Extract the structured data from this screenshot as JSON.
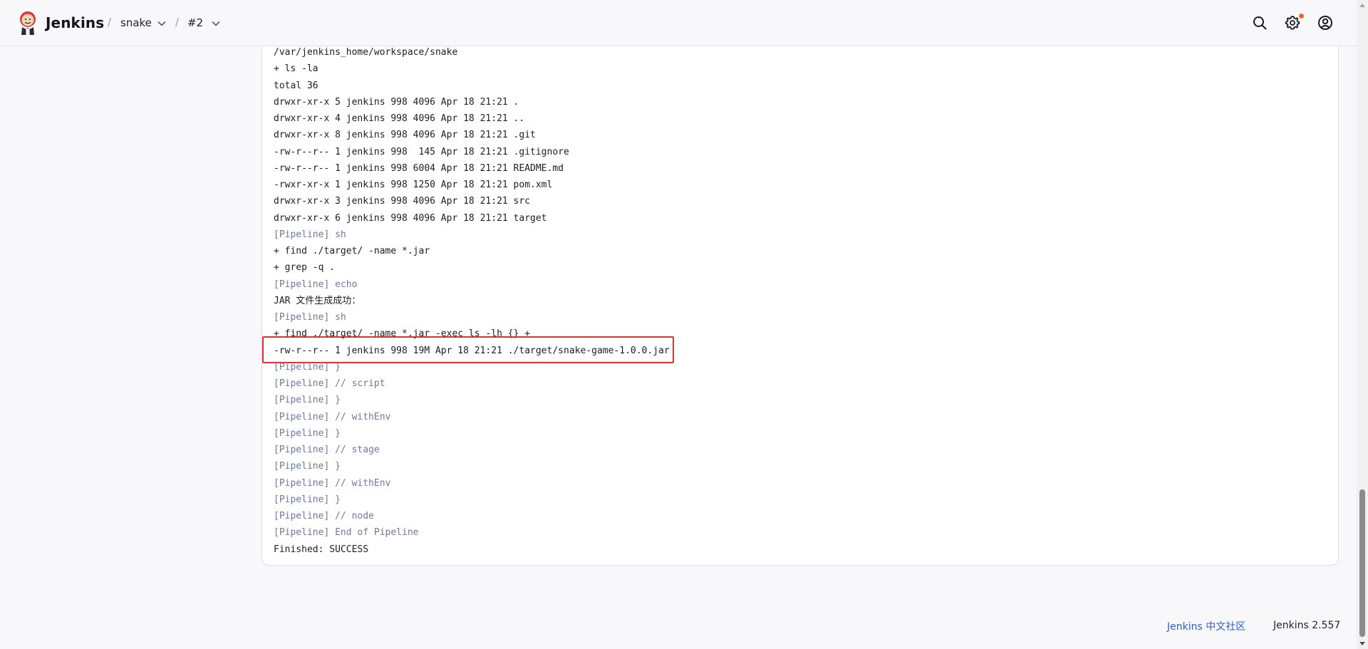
{
  "header": {
    "brand": "Jenkins",
    "breadcrumbs": [
      {
        "label": "snake"
      },
      {
        "label": "#2"
      }
    ],
    "separator": "/",
    "icons": [
      "search-icon",
      "gear-icon",
      "user-account-icon"
    ],
    "notification_dot_color": "#f06a21"
  },
  "console": {
    "lines": [
      {
        "text": "/var/jenkins_home/workspace/snake",
        "type": "output"
      },
      {
        "text": "+ ls -la",
        "type": "output"
      },
      {
        "text": "total 36",
        "type": "output"
      },
      {
        "text": "drwxr-xr-x 5 jenkins 998 4096 Apr 18 21:21 .",
        "type": "output"
      },
      {
        "text": "drwxr-xr-x 4 jenkins 998 4096 Apr 18 21:21 ..",
        "type": "output"
      },
      {
        "text": "drwxr-xr-x 8 jenkins 998 4096 Apr 18 21:21 .git",
        "type": "output"
      },
      {
        "text": "-rw-r--r-- 1 jenkins 998  145 Apr 18 21:21 .gitignore",
        "type": "output"
      },
      {
        "text": "-rw-r--r-- 1 jenkins 998 6004 Apr 18 21:21 README.md",
        "type": "output"
      },
      {
        "text": "-rwxr-xr-x 1 jenkins 998 1250 Apr 18 21:21 pom.xml",
        "type": "output"
      },
      {
        "text": "drwxr-xr-x 3 jenkins 998 4096 Apr 18 21:21 src",
        "type": "output"
      },
      {
        "text": "drwxr-xr-x 6 jenkins 998 4096 Apr 18 21:21 target",
        "type": "output"
      },
      {
        "text": "[Pipeline] sh",
        "type": "pipeline"
      },
      {
        "text": "+ find ./target/ -name *.jar",
        "type": "output"
      },
      {
        "text": "+ grep -q .",
        "type": "output"
      },
      {
        "text": "[Pipeline] echo",
        "type": "pipeline"
      },
      {
        "text": "JAR 文件生成成功：",
        "type": "output"
      },
      {
        "text": "[Pipeline] sh",
        "type": "pipeline"
      },
      {
        "text": "+ find ./target/ -name *.jar -exec ls -lh {} +",
        "type": "output"
      },
      {
        "text": "-rw-r--r-- 1 jenkins 998 19M Apr 18 21:21 ./target/snake-game-1.0.0.jar",
        "type": "output"
      },
      {
        "text": "[Pipeline] }",
        "type": "pipeline"
      },
      {
        "text": "[Pipeline] // script",
        "type": "pipeline"
      },
      {
        "text": "[Pipeline] }",
        "type": "pipeline"
      },
      {
        "text": "[Pipeline] // withEnv",
        "type": "pipeline"
      },
      {
        "text": "[Pipeline] }",
        "type": "pipeline"
      },
      {
        "text": "[Pipeline] // stage",
        "type": "pipeline"
      },
      {
        "text": "[Pipeline] }",
        "type": "pipeline"
      },
      {
        "text": "[Pipeline] // withEnv",
        "type": "pipeline"
      },
      {
        "text": "[Pipeline] }",
        "type": "pipeline"
      },
      {
        "text": "[Pipeline] // node",
        "type": "pipeline"
      },
      {
        "text": "[Pipeline] End of Pipeline",
        "type": "pipeline"
      },
      {
        "text": "Finished: SUCCESS",
        "type": "output"
      }
    ],
    "highlight_color": "#e0303a",
    "pipeline_text_color": "#6d7a9c"
  },
  "footer": {
    "community_link": "Jenkins 中文社区",
    "version": "Jenkins 2.557"
  }
}
